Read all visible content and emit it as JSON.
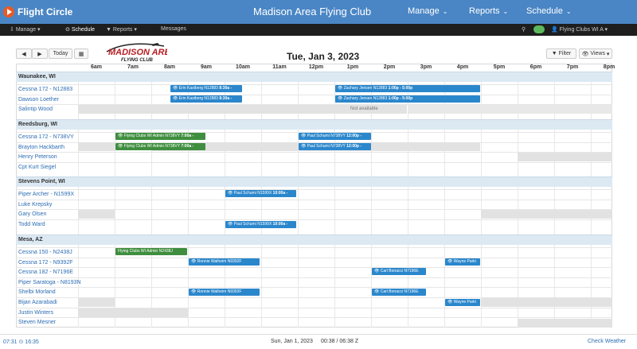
{
  "header": {
    "brand": "Flight Circle",
    "club": "Madison Area Flying Club",
    "nav": [
      {
        "label": "Manage"
      },
      {
        "label": "Reports"
      },
      {
        "label": "Schedule"
      }
    ]
  },
  "subnav": {
    "manage": "Manage",
    "schedule": "Schedule",
    "reports": "Reports",
    "messages": "Messages",
    "user": "Flying Clubs WI A"
  },
  "toolbar": {
    "prev": "◀",
    "next": "▶",
    "today": "Today",
    "date": "Tue, Jan 3, 2023",
    "filter": "Filter",
    "views": "Views"
  },
  "logo": {
    "line1": "MADISON AREA",
    "line2": "FLYING CLUB"
  },
  "hours": [
    "6am",
    "7am",
    "8am",
    "9am",
    "10am",
    "11am",
    "12pm",
    "1pm",
    "2pm",
    "3pm",
    "4pm",
    "5pm",
    "6pm",
    "7pm",
    "8pm"
  ],
  "sections": [
    {
      "name": "Waunakee, WI",
      "rows": [
        "Cessna 172 - N12883",
        "Dawson Loether",
        "Salintip Wood"
      ]
    },
    {
      "name": "Reedsburg, WI",
      "rows": [
        "Cessna 172 - N738VY",
        "Brayton Hackbarth",
        "Henry Peterson",
        "Cpt Kurt Siegel"
      ]
    },
    {
      "name": "Stevens Point, WI",
      "rows": [
        "Piper Archer - N1599X",
        "Luke Krepsky",
        "Gary Olsen",
        "Todd Ward"
      ]
    },
    {
      "name": "Mesa, AZ",
      "rows": [
        "Cessna 150 - N2438J",
        "Cessna 172 - N9392F",
        "Cessna 182 - N7196E",
        "Piper Saratoga - N8193N",
        "Shelbi Morland",
        "Bijan Azarabadi",
        "Justin Winters",
        "Steven Mesner"
      ]
    }
  ],
  "blocks": [
    {
      "text": "Erin Kastberg N12883",
      "time": "8:30a -"
    },
    {
      "text": "Zachary Jensen N12883",
      "time": "1:00p - 5:00p"
    },
    {
      "text": "Erin Kastberg N12883",
      "time": "8:30a -"
    },
    {
      "text": "Zachary Jensen N12883",
      "time": "1:00p - 5:00p"
    },
    {
      "text": "Flying Clubs WI Admin N738VY",
      "time": "7:00a -"
    },
    {
      "text": "Paul Schumi N738VY",
      "time": "12:00p -"
    },
    {
      "text": "Flying Clubs WI Admin N738VY",
      "time": "7:00a -"
    },
    {
      "text": "Paul Schumi N738VY",
      "time": "12:00p -"
    },
    {
      "text": "Paul Schumi N1599X",
      "time": "10:00a -"
    },
    {
      "text": "Paul Schumi N1599X",
      "time": "10:00a -"
    },
    {
      "text": "Flying Clubs WI Admin N2438J",
      "time": ""
    },
    {
      "text": "Ronnie Walheim N9392F",
      "time": ""
    },
    {
      "text": "Wayne Parki",
      "time": ""
    },
    {
      "text": "Carl Bonacci N7196E",
      "time": ""
    },
    {
      "text": "Ronnie Walheim N9392F",
      "time": ""
    },
    {
      "text": "Carl Bonacci N7196E",
      "time": ""
    },
    {
      "text": "Wayne Parki",
      "time": ""
    }
  ],
  "not_available": "Not available",
  "footer": {
    "time": "07:31",
    "time2": "16:35",
    "date": "Sun, Jan 1, 2023",
    "zulu": "00:38 / 06:38 Z",
    "weather": "Check Weather"
  }
}
